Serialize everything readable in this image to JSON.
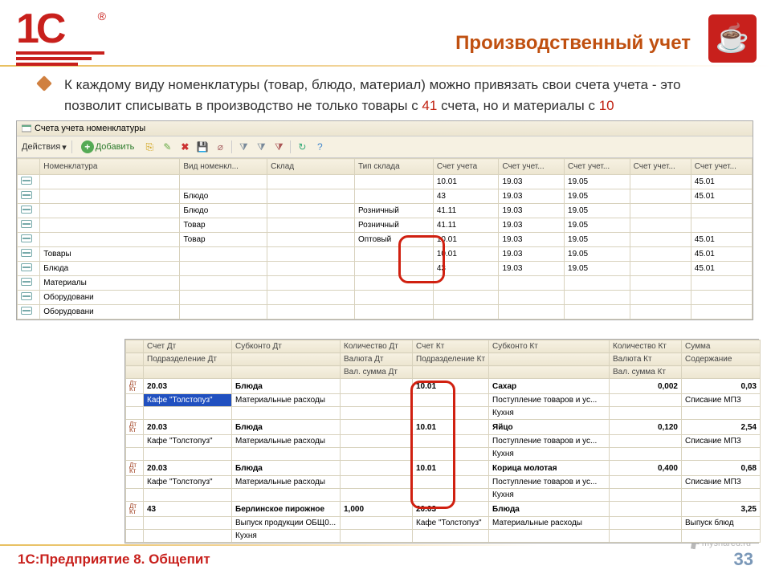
{
  "header": {
    "title": "Производственный учет"
  },
  "intro": {
    "part1": "К каждому виду номенклатуры (товар, блюдо, материал) можно привязать свои счета учета - это позволит списывать в производство не только товары с ",
    "red1": "41",
    "part2": " счета, но и материалы с ",
    "red2": "10"
  },
  "win1": {
    "title": "Счета учета номенклатуры",
    "toolbar": {
      "actions": "Действия",
      "add": "Добавить"
    },
    "columns": [
      "",
      "Номенклатура",
      "Вид номенкл...",
      "Склад",
      "Тип склада",
      "Счет учета",
      "Счет учет...",
      "Счет учет...",
      "Счет учет...",
      "Счет учет..."
    ],
    "rows": [
      {
        "c": [
          "",
          "",
          "",
          "",
          "",
          "10.01",
          "19.03",
          "19.05",
          "",
          "45.01"
        ]
      },
      {
        "c": [
          "",
          "",
          "Блюдо",
          "",
          "",
          "43",
          "19.03",
          "19.05",
          "",
          "45.01"
        ]
      },
      {
        "c": [
          "",
          "",
          "Блюдо",
          "",
          "Розничный",
          "41.11",
          "19.03",
          "19.05",
          "",
          ""
        ]
      },
      {
        "c": [
          "",
          "",
          "Товар",
          "",
          "Розничный",
          "41.11",
          "19.03",
          "19.05",
          "",
          ""
        ]
      },
      {
        "c": [
          "",
          "",
          "Товар",
          "",
          "Оптовый",
          "10.01",
          "19.03",
          "19.05",
          "",
          "45.01"
        ]
      },
      {
        "c": [
          "",
          "Товары",
          "",
          "",
          "",
          "10.01",
          "19.03",
          "19.05",
          "",
          "45.01"
        ]
      },
      {
        "c": [
          "",
          "Блюда",
          "",
          "",
          "",
          "43",
          "19.03",
          "19.05",
          "",
          "45.01"
        ]
      },
      {
        "c": [
          "",
          "Материалы",
          "",
          "",
          "",
          "",
          "",
          "",
          "",
          ""
        ]
      },
      {
        "c": [
          "",
          "Оборудовани",
          "",
          "",
          "",
          "",
          "",
          "",
          "",
          ""
        ]
      },
      {
        "c": [
          "",
          "Оборудовани",
          "",
          "",
          "",
          "",
          "",
          "",
          "",
          ""
        ]
      }
    ]
  },
  "win2": {
    "h1": [
      "",
      "Счет Дт",
      "Субконто Дт",
      "Количество Дт",
      "Счет Кт",
      "Субконто Кт",
      "Количество Кт",
      "Сумма"
    ],
    "h2": [
      "",
      "Подразделение Дт",
      "",
      "Валюта Дт",
      "Подразделение Кт",
      "",
      "Валюта Кт",
      "Содержание"
    ],
    "h3": [
      "",
      "",
      "",
      "Вал. сумма Дт",
      "",
      "",
      "Вал. сумма Кт",
      ""
    ],
    "groups": [
      {
        "r1": [
          "20.03",
          "Блюда",
          "",
          "10.01",
          "Сахар",
          "0,002",
          "0,03"
        ],
        "r2": [
          "Кафе \"Толстопуз\"",
          "Материальные расходы",
          "",
          "",
          "Поступление товаров и ус...",
          "",
          "Списание МПЗ"
        ],
        "r3": [
          "",
          "",
          "",
          "",
          "Кухня",
          "",
          ""
        ],
        "sel": true
      },
      {
        "r1": [
          "20.03",
          "Блюда",
          "",
          "10.01",
          "Яйцо",
          "0,120",
          "2,54"
        ],
        "r2": [
          "Кафе \"Толстопуз\"",
          "Материальные расходы",
          "",
          "",
          "Поступление товаров и ус...",
          "",
          "Списание МПЗ"
        ],
        "r3": [
          "",
          "",
          "",
          "",
          "Кухня",
          "",
          ""
        ]
      },
      {
        "r1": [
          "20.03",
          "Блюда",
          "",
          "10.01",
          "Корица молотая",
          "0,400",
          "0,68"
        ],
        "r2": [
          "Кафе \"Толстопуз\"",
          "Материальные расходы",
          "",
          "",
          "Поступление товаров и ус...",
          "",
          "Списание МПЗ"
        ],
        "r3": [
          "",
          "",
          "",
          "",
          "Кухня",
          "",
          ""
        ]
      },
      {
        "r1": [
          "43",
          "Берлинское пирожное",
          "1,000",
          "20.03",
          "Блюда",
          "",
          "3,25"
        ],
        "r2": [
          "",
          "Выпуск продукции ОБЩ0...",
          "",
          "Кафе \"Толстопуз\"",
          "Материальные расходы",
          "",
          "Выпуск блюд"
        ],
        "r3": [
          "",
          "Кухня",
          "",
          "",
          "",
          "",
          ""
        ]
      }
    ]
  },
  "footer": {
    "left": "1С:Предприятие 8. Общепит",
    "page": "33",
    "share": "myshared.ru"
  }
}
